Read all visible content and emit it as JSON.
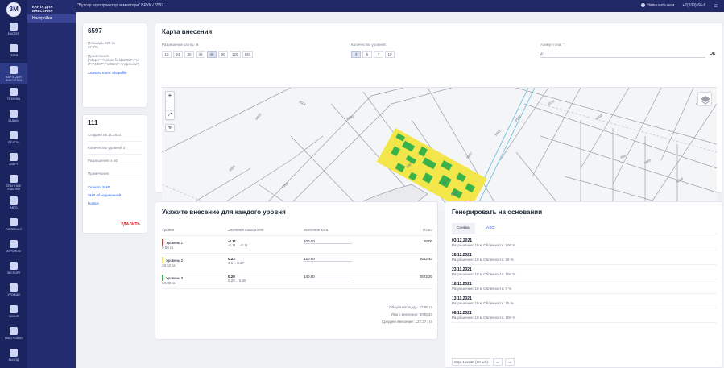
{
  "topbar": {
    "breadcrumb": "\"Булгар агропроектор земелтори\" БРУК / 6597",
    "help": "Напишите нам",
    "user": "+7(939)-66-8"
  },
  "rail": {
    "logo": "ЗМ",
    "items": [
      "МАСТЕР",
      "ПОЛЯ",
      "КАРТА ДЛЯ ВНЕСЕНИЯ",
      "ТЕХНИКА",
      "ЗАДАЧИ",
      "ОТЧЁТЫ",
      "АЛЕРТ",
      "ОПЫТНЫЕ УЧАСТКИ",
      "АВТО",
      "ПОСЕВНАЯ",
      "АГРОНОМ",
      "ЭКСПОРТ",
      "УРОЖАЙ",
      "ХИМИЯ",
      "НАСТРОЙКИ",
      "ВЫХОД"
    ]
  },
  "nav": {
    "title": "КАРТА ДЛЯ ВНЕСЕНИЯ",
    "item": "Настройки"
  },
  "field_card": {
    "id": "6597",
    "area_label": "Площадь 225 га",
    "area_value": "37.7%",
    "rules_label": "Примечания",
    "rules_text": "{\"slope\": \"isolate fields2002\", \"oid\": \"1397\", \"culture\": \"Агроном\"}",
    "shapefile_link": "Скачать ESRI Shapefile"
  },
  "map_card": {
    "id": "111",
    "created": "Создана 08.11.2021",
    "levels": "Количество уровней 3",
    "resolution": "Разрешение: х 60",
    "note_label": "Примечания",
    "download_shp": "Скачать SHP",
    "shp_combined": "SHP объединенный",
    "isobus": "IsoBus",
    "delete": "УДАЛИТЬ"
  },
  "apply_map": {
    "title": "Карта внесения",
    "resolution_label": "Разрешение карты, м:",
    "resolution_options": [
      "10",
      "24",
      "30",
      "36",
      "48",
      "90",
      "120",
      "150"
    ],
    "resolution_selected": "48",
    "levels_label": "Количество уровней:",
    "levels_options": [
      "3",
      "5",
      "7",
      "10"
    ],
    "levels_selected": "3",
    "azimuth_label": "Азимут гона, °:",
    "azimuth_value": "27",
    "ok": "OK",
    "parcel_labels": [
      "6603",
      "6504",
      "6580",
      "6587",
      "6575",
      "6568",
      "6597",
      "6591",
      "6572",
      "6578",
      "6593",
      "6565",
      "6510",
      "6606",
      "6592",
      "6561",
      "6571"
    ]
  },
  "levels_table": {
    "title": "Укажите внесение для каждого уровня",
    "headers": [
      "Уровни",
      "Значения показателя",
      "Внесение кг/га",
      "Итого"
    ],
    "rows": [
      {
        "name": "Уровень 1",
        "area": "0.58 га",
        "value": "-0.11",
        "range": "-0.11 .. -0.11",
        "rate": "100.00",
        "total": "58.00",
        "color": "#e53935"
      },
      {
        "name": "Уровень 2",
        "area": "28.52 га",
        "value": "0.23",
        "range": "0.1 .. 0.27",
        "rate": "120.00",
        "total": "3542.40",
        "color": "#f2e64a"
      },
      {
        "name": "Уровень 3",
        "area": "18.03 га",
        "value": "0.29",
        "range": "0.28 .. 0.30",
        "rate": "140.00",
        "total": "2523.20",
        "color": "#37b34a"
      }
    ],
    "total_area": "Общая площадь: 47.08 га",
    "total_amount": "Итого внесение: 6098.40",
    "avg": "Среднее внесение: 127.37 / га"
  },
  "generate": {
    "title": "Генерировать на основании",
    "tabs": [
      "Снимки",
      "АХО"
    ],
    "list": [
      {
        "date": "03.12.2021",
        "meta": "Разрешение: 10 м Облачность: 100 %"
      },
      {
        "date": "28.11.2021",
        "meta": "Разрешение: 10 м Облачность: 98 %"
      },
      {
        "date": "23.11.2021",
        "meta": "Разрешение: 10 м Облачность: 100 %"
      },
      {
        "date": "18.11.2021",
        "meta": "Разрешение: 10 м Облачность: 0 %"
      },
      {
        "date": "13.11.2021",
        "meta": "Разрешение: 10 м Облачность: 15 %"
      },
      {
        "date": "08.11.2021",
        "meta": "Разрешение: 10 м Облачность: 100 %"
      }
    ],
    "pagination": "Стр. 1 из 10 (60 шт.)"
  },
  "colors": {
    "red": "#e53935",
    "yellow": "#f2e64a",
    "green": "#37b34a",
    "navy": "#202866",
    "link": "#2563eb"
  }
}
